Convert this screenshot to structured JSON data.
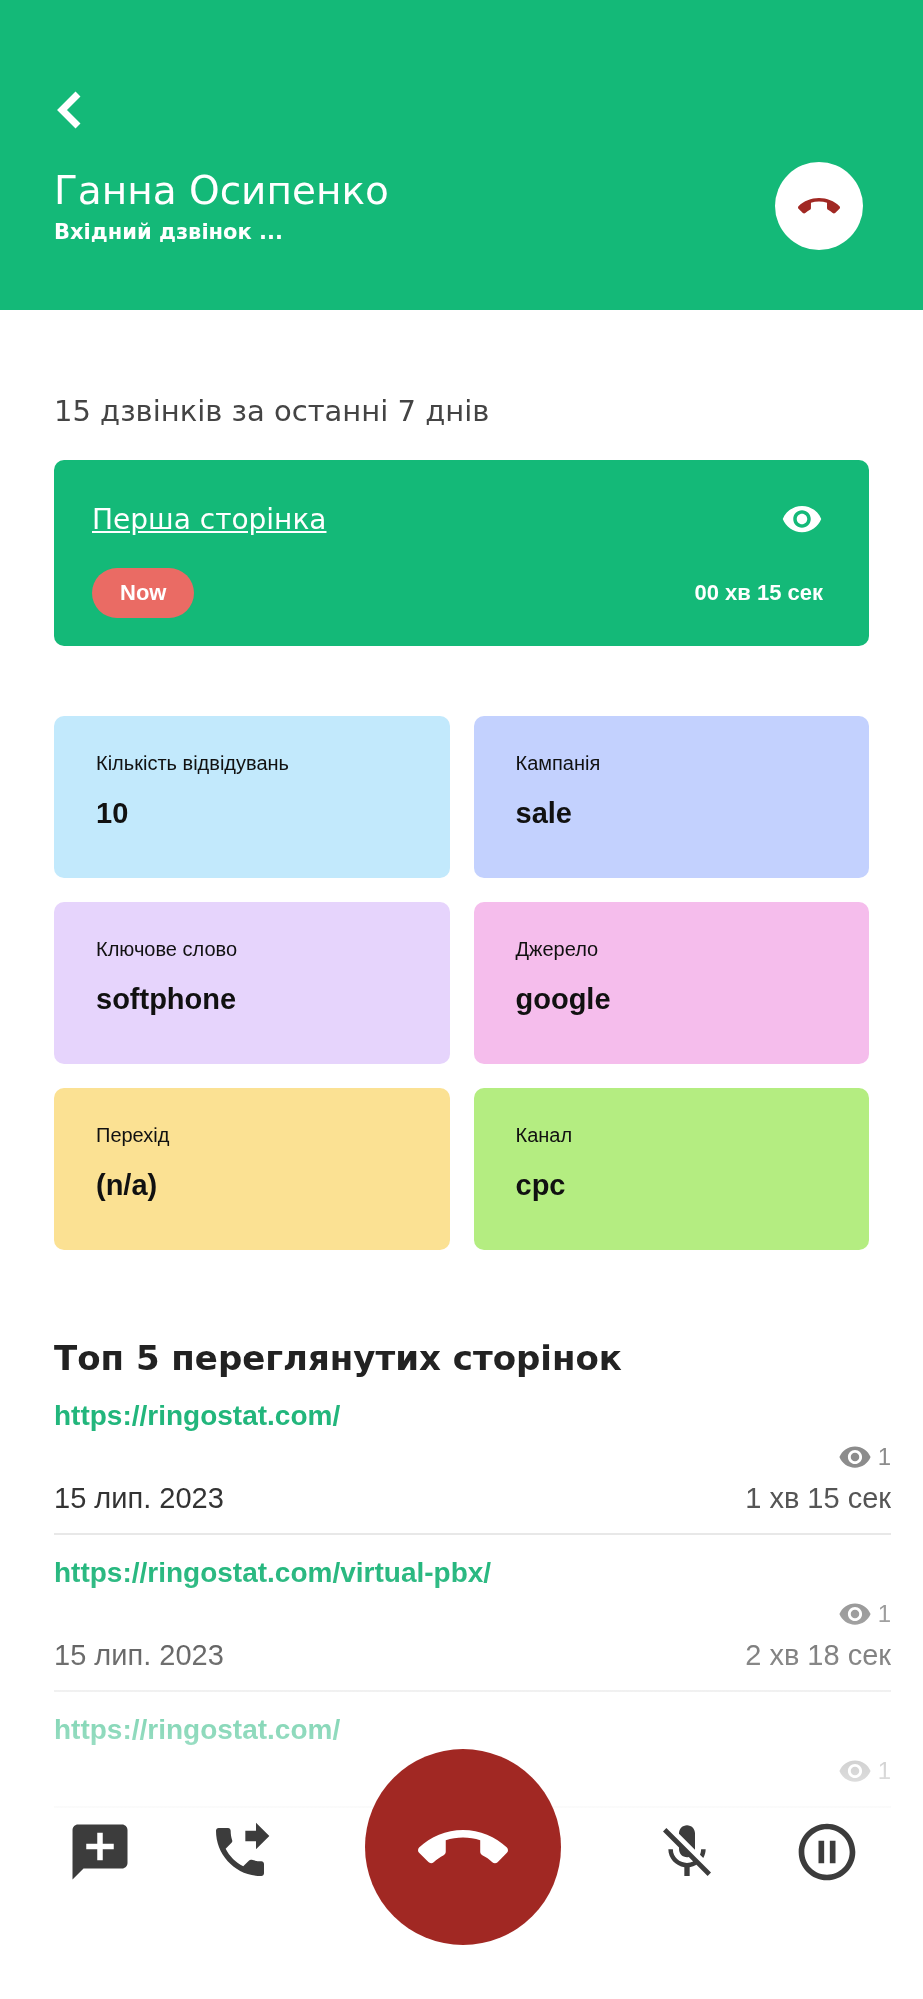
{
  "header": {
    "name": "Ганна Осипенко",
    "subtitle": "Вхідний дзвінок ..."
  },
  "calls_summary": "15 дзвінків за останні 7 днів",
  "page_card": {
    "title": "Перша сторінка",
    "badge": "Now",
    "duration": "00 хв 15 сек"
  },
  "stats": [
    {
      "label": "Кількість відвідувань",
      "value": "10",
      "color": "#c2e9fc"
    },
    {
      "label": "Кампанія",
      "value": "sale",
      "color": "#c3d1fe"
    },
    {
      "label": "Ключове слово",
      "value": "softphone",
      "color": "#e6d4fc"
    },
    {
      "label": "Джерело",
      "value": "google",
      "color": "#f5bdec"
    },
    {
      "label": "Перехід",
      "value": "(n/a)",
      "color": "#fbe193"
    },
    {
      "label": "Канал",
      "value": "cpc",
      "color": "#b4ed81"
    }
  ],
  "top_pages": {
    "title": "Топ 5 переглянутих сторінок",
    "pages": [
      {
        "url": "https://ringostat.com/",
        "views": "1",
        "date": "15 лип. 2023",
        "duration": "1 хв 15 сек"
      },
      {
        "url": "https://ringostat.com/virtual-pbx/",
        "views": "1",
        "date": "15 лип. 2023",
        "duration": "2 хв 18 сек"
      },
      {
        "url": "https://ringostat.com/",
        "views": "1"
      }
    ]
  }
}
